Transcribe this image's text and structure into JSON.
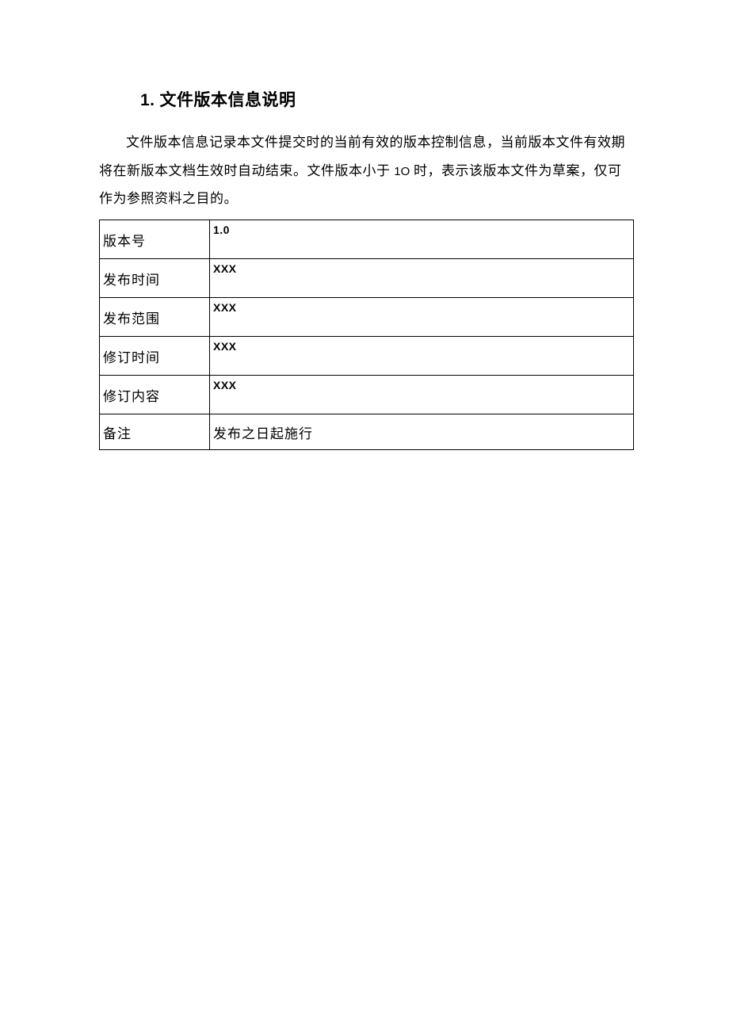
{
  "heading": {
    "number": "1.",
    "title": "文件版本信息说明"
  },
  "paragraph": {
    "seg1": "文件版本信息记录本文件提交时的当前有效的版本控制信息，当前版本文件有效期将在新版本文档生效时自动结束。文件版本小于 ",
    "ascii": "1O",
    "seg2": " 时，表示该版本文件为草案，仅可作为参照资料之目的。"
  },
  "table": {
    "rows": [
      {
        "label": "版本号",
        "value": "1.0",
        "ascii": true
      },
      {
        "label": "发布时间",
        "value": "XXX",
        "ascii": true
      },
      {
        "label": "发布范围",
        "value": "XXX",
        "ascii": true
      },
      {
        "label": "修订时间",
        "value": "XXX",
        "ascii": true
      },
      {
        "label": "修订内容",
        "value": "XXX",
        "ascii": true
      },
      {
        "label": "备注",
        "value": "发布之日起施行",
        "ascii": false
      }
    ]
  }
}
